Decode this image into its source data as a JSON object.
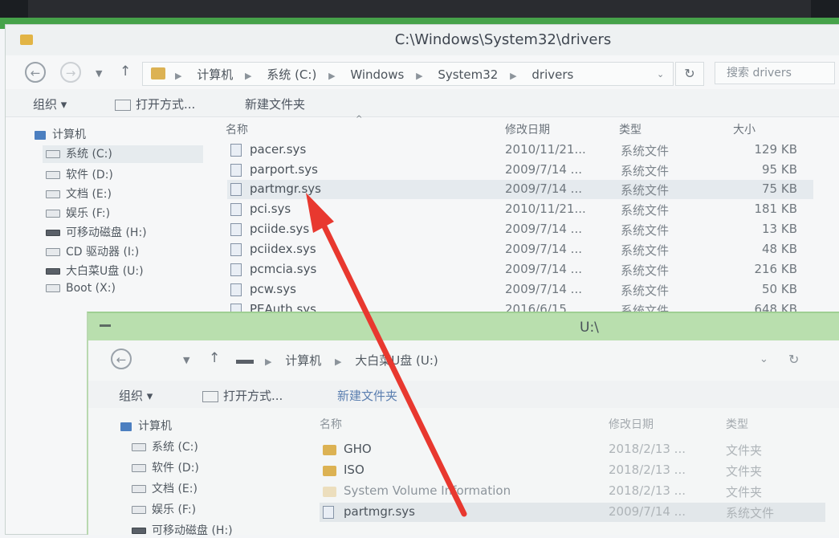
{
  "main_window": {
    "title": "C:\\Windows\\System32\\drivers",
    "breadcrumbs": [
      "计算机",
      "系统 (C:)",
      "Windows",
      "System32",
      "drivers"
    ],
    "search_placeholder": "搜索 drivers",
    "toolbar": {
      "organize": "组织 ▾",
      "open_with": "打开方式...",
      "new_folder": "新建文件夹"
    },
    "nav_items": [
      {
        "label": "计算机",
        "icon": "computer-icon"
      },
      {
        "label": "系统 (C:)",
        "icon": "drive-icon"
      },
      {
        "label": "软件 (D:)",
        "icon": "drive-icon"
      },
      {
        "label": "文档 (E:)",
        "icon": "drive-icon"
      },
      {
        "label": "娱乐 (F:)",
        "icon": "drive-icon"
      },
      {
        "label": "可移动磁盘 (H:)",
        "icon": "usb-drive-icon"
      },
      {
        "label": "CD 驱动器 (I:)",
        "icon": "cd-drive-icon"
      },
      {
        "label": "大白菜U盘 (U:)",
        "icon": "usb-drive-icon"
      },
      {
        "label": "Boot (X:)",
        "icon": "drive-icon"
      }
    ],
    "columns": {
      "name": "名称",
      "date": "修改日期",
      "type": "类型",
      "size": "大小"
    },
    "files": [
      {
        "name": "pacer.sys",
        "date": "2010/11/21...",
        "type": "系统文件",
        "size": "129 KB"
      },
      {
        "name": "parport.sys",
        "date": "2009/7/14 ...",
        "type": "系统文件",
        "size": "95 KB"
      },
      {
        "name": "partmgr.sys",
        "date": "2009/7/14 ...",
        "type": "系统文件",
        "size": "75 KB"
      },
      {
        "name": "pci.sys",
        "date": "2010/11/21...",
        "type": "系统文件",
        "size": "181 KB"
      },
      {
        "name": "pciide.sys",
        "date": "2009/7/14 ...",
        "type": "系统文件",
        "size": "13 KB"
      },
      {
        "name": "pciidex.sys",
        "date": "2009/7/14 ...",
        "type": "系统文件",
        "size": "48 KB"
      },
      {
        "name": "pcmcia.sys",
        "date": "2009/7/14 ...",
        "type": "系统文件",
        "size": "216 KB"
      },
      {
        "name": "pcw.sys",
        "date": "2009/7/14 ...",
        "type": "系统文件",
        "size": "50 KB"
      },
      {
        "name": "PEAuth.sys",
        "date": "2016/6/15 ...",
        "type": "系统文件",
        "size": "648 KB"
      }
    ]
  },
  "second_window": {
    "title": "U:\\",
    "breadcrumbs": [
      "计算机",
      "大白菜U盘 (U:)"
    ],
    "toolbar": {
      "organize": "组织 ▾",
      "open_with": "打开方式...",
      "new_folder": "新建文件夹"
    },
    "nav_items": [
      {
        "label": "计算机"
      },
      {
        "label": "系统 (C:)"
      },
      {
        "label": "软件 (D:)"
      },
      {
        "label": "文档 (E:)"
      },
      {
        "label": "娱乐 (F:)"
      },
      {
        "label": "可移动磁盘 (H:)"
      }
    ],
    "columns": {
      "name": "名称",
      "date": "修改日期",
      "type": "类型"
    },
    "files": [
      {
        "name": "GHO",
        "date": "2018/2/13 ...",
        "type": "文件夹"
      },
      {
        "name": "ISO",
        "date": "2018/2/13 ...",
        "type": "文件夹"
      },
      {
        "name": "System Volume Information",
        "date": "2018/2/13 ...",
        "type": "文件夹"
      },
      {
        "name": "partmgr.sys",
        "date": "2009/7/14 ...",
        "type": "系统文件"
      }
    ]
  },
  "annotation": {
    "arrow_color": "#e8382f"
  }
}
